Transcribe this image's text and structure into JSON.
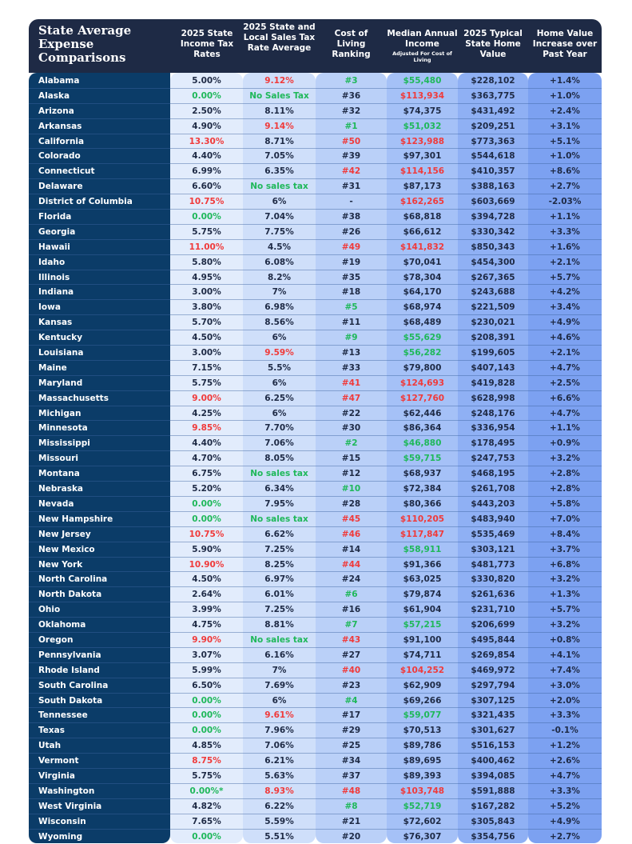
{
  "title": "State Average Expense Comparisons",
  "colors": {
    "red": "#f03a3a",
    "green": "#1fb85a",
    "header_bg": "#1e2a45",
    "state_bg": "#0b3c68"
  },
  "headers": [
    {
      "label": "2025 State Income Tax Rates",
      "sub": ""
    },
    {
      "label": "2025 State and Local Sales Tax Rate Average",
      "sub": ""
    },
    {
      "label": "Cost of Living Ranking",
      "sub": ""
    },
    {
      "label": "Median Annual Income",
      "sub": "Adjusted For Cost of Living"
    },
    {
      "label": "2025 Typical State Home Value",
      "sub": ""
    },
    {
      "label": "Home Value Increase over Past Year",
      "sub": ""
    }
  ],
  "rows": [
    {
      "state": "Alabama",
      "income_tax": "5.00%",
      "sales_tax": "9.12%",
      "col_rank": "#3",
      "median_income": "$55,480",
      "home_value": "$228,102",
      "home_increase": "+1.4%",
      "hl": {
        "sales_tax": "red",
        "col_rank": "green",
        "median_income": "green"
      }
    },
    {
      "state": "Alaska",
      "income_tax": "0.00%",
      "sales_tax": "No Sales Tax",
      "col_rank": "#36",
      "median_income": "$113,934",
      "home_value": "$363,775",
      "home_increase": "+1.0%",
      "hl": {
        "income_tax": "green",
        "sales_tax": "green",
        "median_income": "red"
      }
    },
    {
      "state": "Arizona",
      "income_tax": "2.50%",
      "sales_tax": "8.11%",
      "col_rank": "#32",
      "median_income": "$74,375",
      "home_value": "$431,492",
      "home_increase": "+2.4%",
      "hl": {}
    },
    {
      "state": "Arkansas",
      "income_tax": "4.90%",
      "sales_tax": "9.14%",
      "col_rank": "#1",
      "median_income": "$51,032",
      "home_value": "$209,251",
      "home_increase": "+3.1%",
      "hl": {
        "sales_tax": "red",
        "col_rank": "green",
        "median_income": "green"
      }
    },
    {
      "state": "California",
      "income_tax": "13.30%",
      "sales_tax": "8.71%",
      "col_rank": "#50",
      "median_income": "$123,988",
      "home_value": "$773,363",
      "home_increase": "+5.1%",
      "hl": {
        "income_tax": "red",
        "col_rank": "red",
        "median_income": "red"
      }
    },
    {
      "state": "Colorado",
      "income_tax": "4.40%",
      "sales_tax": "7.05%",
      "col_rank": "#39",
      "median_income": "$97,301",
      "home_value": "$544,618",
      "home_increase": "+1.0%",
      "hl": {}
    },
    {
      "state": "Connecticut",
      "income_tax": "6.99%",
      "sales_tax": "6.35%",
      "col_rank": "#42",
      "median_income": "$114,156",
      "home_value": "$410,357",
      "home_increase": "+8.6%",
      "hl": {
        "col_rank": "red",
        "median_income": "red"
      }
    },
    {
      "state": "Delaware",
      "income_tax": "6.60%",
      "sales_tax": "No sales tax",
      "col_rank": "#31",
      "median_income": "$87,173",
      "home_value": "$388,163",
      "home_increase": "+2.7%",
      "hl": {
        "sales_tax": "green"
      }
    },
    {
      "state": "District of Columbia",
      "income_tax": "10.75%",
      "sales_tax": "6%",
      "col_rank": "-",
      "median_income": "$162,265",
      "home_value": "$603,669",
      "home_increase": "-2.03%",
      "hl": {
        "income_tax": "red",
        "median_income": "red"
      }
    },
    {
      "state": "Florida",
      "income_tax": "0.00%",
      "sales_tax": "7.04%",
      "col_rank": "#38",
      "median_income": "$68,818",
      "home_value": "$394,728",
      "home_increase": "+1.1%",
      "hl": {
        "income_tax": "green"
      }
    },
    {
      "state": "Georgia",
      "income_tax": "5.75%",
      "sales_tax": "7.75%",
      "col_rank": "#26",
      "median_income": "$66,612",
      "home_value": "$330,342",
      "home_increase": "+3.3%",
      "hl": {}
    },
    {
      "state": "Hawaii",
      "income_tax": "11.00%",
      "sales_tax": "4.5%",
      "col_rank": "#49",
      "median_income": "$141,832",
      "home_value": "$850,343",
      "home_increase": "+1.6%",
      "hl": {
        "income_tax": "red",
        "col_rank": "red",
        "median_income": "red"
      }
    },
    {
      "state": "Idaho",
      "income_tax": "5.80%",
      "sales_tax": "6.08%",
      "col_rank": "#19",
      "median_income": "$70,041",
      "home_value": "$454,300",
      "home_increase": "+2.1%",
      "hl": {}
    },
    {
      "state": "Illinois",
      "income_tax": "4.95%",
      "sales_tax": "8.2%",
      "col_rank": "#35",
      "median_income": "$78,304",
      "home_value": "$267,365",
      "home_increase": "+5.7%",
      "hl": {}
    },
    {
      "state": "Indiana",
      "income_tax": "3.00%",
      "sales_tax": "7%",
      "col_rank": "#18",
      "median_income": "$64,170",
      "home_value": "$243,688",
      "home_increase": "+4.2%",
      "hl": {}
    },
    {
      "state": "Iowa",
      "income_tax": "3.80%",
      "sales_tax": "6.98%",
      "col_rank": "#5",
      "median_income": "$68,974",
      "home_value": "$221,509",
      "home_increase": "+3.4%",
      "hl": {
        "col_rank": "green"
      }
    },
    {
      "state": "Kansas",
      "income_tax": "5.70%",
      "sales_tax": "8.56%",
      "col_rank": "#11",
      "median_income": "$68,489",
      "home_value": "$230,021",
      "home_increase": "+4.9%",
      "hl": {}
    },
    {
      "state": "Kentucky",
      "income_tax": "4.50%",
      "sales_tax": "6%",
      "col_rank": "#9",
      "median_income": "$55,629",
      "home_value": "$208,391",
      "home_increase": "+4.6%",
      "hl": {
        "col_rank": "green",
        "median_income": "green"
      }
    },
    {
      "state": "Louisiana",
      "income_tax": "3.00%",
      "sales_tax": "9.59%",
      "col_rank": "#13",
      "median_income": "$56,282",
      "home_value": "$199,605",
      "home_increase": "+2.1%",
      "hl": {
        "sales_tax": "red",
        "median_income": "green"
      }
    },
    {
      "state": "Maine",
      "income_tax": "7.15%",
      "sales_tax": "5.5%",
      "col_rank": "#33",
      "median_income": "$79,800",
      "home_value": "$407,143",
      "home_increase": "+4.7%",
      "hl": {}
    },
    {
      "state": "Maryland",
      "income_tax": "5.75%",
      "sales_tax": "6%",
      "col_rank": "#41",
      "median_income": "$124,693",
      "home_value": "$419,828",
      "home_increase": "+2.5%",
      "hl": {
        "col_rank": "red",
        "median_income": "red"
      }
    },
    {
      "state": "Massachusetts",
      "income_tax": "9.00%",
      "sales_tax": "6.25%",
      "col_rank": "#47",
      "median_income": "$127,760",
      "home_value": "$628,998",
      "home_increase": "+6.6%",
      "hl": {
        "income_tax": "red",
        "col_rank": "red",
        "median_income": "red"
      }
    },
    {
      "state": "Michigan",
      "income_tax": "4.25%",
      "sales_tax": "6%",
      "col_rank": "#22",
      "median_income": "$62,446",
      "home_value": "$248,176",
      "home_increase": "+4.7%",
      "hl": {}
    },
    {
      "state": "Minnesota",
      "income_tax": "9.85%",
      "sales_tax": "7.70%",
      "col_rank": "#30",
      "median_income": "$86,364",
      "home_value": "$336,954",
      "home_increase": "+1.1%",
      "hl": {
        "income_tax": "red"
      }
    },
    {
      "state": "Mississippi",
      "income_tax": "4.40%",
      "sales_tax": "7.06%",
      "col_rank": "#2",
      "median_income": "$46,880",
      "home_value": "$178,495",
      "home_increase": "+0.9%",
      "hl": {
        "col_rank": "green",
        "median_income": "green"
      }
    },
    {
      "state": "Missouri",
      "income_tax": "4.70%",
      "sales_tax": "8.05%",
      "col_rank": "#15",
      "median_income": "$59,715",
      "home_value": "$247,753",
      "home_increase": "+3.2%",
      "hl": {
        "median_income": "green"
      }
    },
    {
      "state": "Montana",
      "income_tax": "6.75%",
      "sales_tax": "No sales tax",
      "col_rank": "#12",
      "median_income": "$68,937",
      "home_value": "$468,195",
      "home_increase": "+2.8%",
      "hl": {
        "sales_tax": "green"
      }
    },
    {
      "state": "Nebraska",
      "income_tax": "5.20%",
      "sales_tax": "6.34%",
      "col_rank": "#10",
      "median_income": "$72,384",
      "home_value": "$261,708",
      "home_increase": "+2.8%",
      "hl": {
        "col_rank": "green"
      }
    },
    {
      "state": "Nevada",
      "income_tax": "0.00%",
      "sales_tax": "7.95%",
      "col_rank": "#28",
      "median_income": "$80,366",
      "home_value": "$443,203",
      "home_increase": "+5.8%",
      "hl": {
        "income_tax": "green"
      }
    },
    {
      "state": "New Hampshire",
      "income_tax": "0.00%",
      "sales_tax": "No sales tax",
      "col_rank": "#45",
      "median_income": "$110,205",
      "home_value": "$483,940",
      "home_increase": "+7.0%",
      "hl": {
        "income_tax": "green",
        "sales_tax": "green",
        "col_rank": "red",
        "median_income": "red"
      }
    },
    {
      "state": "New Jersey",
      "income_tax": "10.75%",
      "sales_tax": "6.62%",
      "col_rank": "#46",
      "median_income": "$117,847",
      "home_value": "$535,469",
      "home_increase": "+8.4%",
      "hl": {
        "income_tax": "red",
        "col_rank": "red",
        "median_income": "red"
      }
    },
    {
      "state": "New Mexico",
      "income_tax": "5.90%",
      "sales_tax": "7.25%",
      "col_rank": "#14",
      "median_income": "$58,911",
      "home_value": "$303,121",
      "home_increase": "+3.7%",
      "hl": {
        "median_income": "green"
      }
    },
    {
      "state": "New York",
      "income_tax": "10.90%",
      "sales_tax": "8.25%",
      "col_rank": "#44",
      "median_income": "$91,366",
      "home_value": "$481,773",
      "home_increase": "+6.8%",
      "hl": {
        "income_tax": "red",
        "col_rank": "red"
      }
    },
    {
      "state": "North Carolina",
      "income_tax": "4.50%",
      "sales_tax": "6.97%",
      "col_rank": "#24",
      "median_income": "$63,025",
      "home_value": "$330,820",
      "home_increase": "+3.2%",
      "hl": {}
    },
    {
      "state": "North Dakota",
      "income_tax": "2.64%",
      "sales_tax": "6.01%",
      "col_rank": "#6",
      "median_income": "$79,874",
      "home_value": "$261,636",
      "home_increase": "+1.3%",
      "hl": {
        "col_rank": "green"
      }
    },
    {
      "state": "Ohio",
      "income_tax": "3.99%",
      "sales_tax": "7.25%",
      "col_rank": "#16",
      "median_income": "$61,904",
      "home_value": "$231,710",
      "home_increase": "+5.7%",
      "hl": {}
    },
    {
      "state": "Oklahoma",
      "income_tax": "4.75%",
      "sales_tax": "8.81%",
      "col_rank": "#7",
      "median_income": "$57,215",
      "home_value": "$206,699",
      "home_increase": "+3.2%",
      "hl": {
        "col_rank": "green",
        "median_income": "green"
      }
    },
    {
      "state": "Oregon",
      "income_tax": "9.90%",
      "sales_tax": "No sales tax",
      "col_rank": "#43",
      "median_income": "$91,100",
      "home_value": "$495,844",
      "home_increase": "+0.8%",
      "hl": {
        "income_tax": "red",
        "sales_tax": "green",
        "col_rank": "red"
      }
    },
    {
      "state": "Pennsylvania",
      "income_tax": "3.07%",
      "sales_tax": "6.16%",
      "col_rank": "#27",
      "median_income": "$74,711",
      "home_value": "$269,854",
      "home_increase": "+4.1%",
      "hl": {}
    },
    {
      "state": "Rhode Island",
      "income_tax": "5.99%",
      "sales_tax": "7%",
      "col_rank": "#40",
      "median_income": "$104,252",
      "home_value": "$469,972",
      "home_increase": "+7.4%",
      "hl": {
        "col_rank": "red",
        "median_income": "red"
      }
    },
    {
      "state": "South Carolina",
      "income_tax": "6.50%",
      "sales_tax": "7.69%",
      "col_rank": "#23",
      "median_income": "$62,909",
      "home_value": "$297,794",
      "home_increase": "+3.0%",
      "hl": {}
    },
    {
      "state": "South Dakota",
      "income_tax": "0.00%",
      "sales_tax": "6%",
      "col_rank": "#4",
      "median_income": "$69,266",
      "home_value": "$307,125",
      "home_increase": "+2.0%",
      "hl": {
        "income_tax": "green",
        "col_rank": "green"
      }
    },
    {
      "state": "Tennessee",
      "income_tax": "0.00%",
      "sales_tax": "9.61%",
      "col_rank": "#17",
      "median_income": "$59,077",
      "home_value": "$321,435",
      "home_increase": "+3.3%",
      "hl": {
        "income_tax": "green",
        "sales_tax": "red",
        "median_income": "green"
      }
    },
    {
      "state": "Texas",
      "income_tax": "0.00%",
      "sales_tax": "7.96%",
      "col_rank": "#29",
      "median_income": "$70,513",
      "home_value": "$301,627",
      "home_increase": "-0.1%",
      "hl": {
        "income_tax": "green"
      }
    },
    {
      "state": "Utah",
      "income_tax": "4.85%",
      "sales_tax": "7.06%",
      "col_rank": "#25",
      "median_income": "$89,786",
      "home_value": "$516,153",
      "home_increase": "+1.2%",
      "hl": {}
    },
    {
      "state": "Vermont",
      "income_tax": "8.75%",
      "sales_tax": "6.21%",
      "col_rank": "#34",
      "median_income": "$89,695",
      "home_value": "$400,462",
      "home_increase": "+2.6%",
      "hl": {
        "income_tax": "red"
      }
    },
    {
      "state": "Virginia",
      "income_tax": "5.75%",
      "sales_tax": "5.63%",
      "col_rank": "#37",
      "median_income": "$89,393",
      "home_value": "$394,085",
      "home_increase": "+4.7%",
      "hl": {}
    },
    {
      "state": "Washington",
      "income_tax": "0.00%*",
      "sales_tax": "8.93%",
      "col_rank": "#48",
      "median_income": "$103,748",
      "home_value": "$591,888",
      "home_increase": "+3.3%",
      "hl": {
        "income_tax": "green",
        "sales_tax": "red",
        "col_rank": "red",
        "median_income": "red"
      }
    },
    {
      "state": "West Virginia",
      "income_tax": "4.82%",
      "sales_tax": "6.22%",
      "col_rank": "#8",
      "median_income": "$52,719",
      "home_value": "$167,282",
      "home_increase": "+5.2%",
      "hl": {
        "col_rank": "green",
        "median_income": "green"
      }
    },
    {
      "state": "Wisconsin",
      "income_tax": "7.65%",
      "sales_tax": "5.59%",
      "col_rank": "#21",
      "median_income": "$72,602",
      "home_value": "$305,843",
      "home_increase": "+4.9%",
      "hl": {}
    },
    {
      "state": "Wyoming",
      "income_tax": "0.00%",
      "sales_tax": "5.51%",
      "col_rank": "#20",
      "median_income": "$76,307",
      "home_value": "$354,756",
      "home_increase": "+2.7%",
      "hl": {
        "income_tax": "green"
      }
    }
  ]
}
